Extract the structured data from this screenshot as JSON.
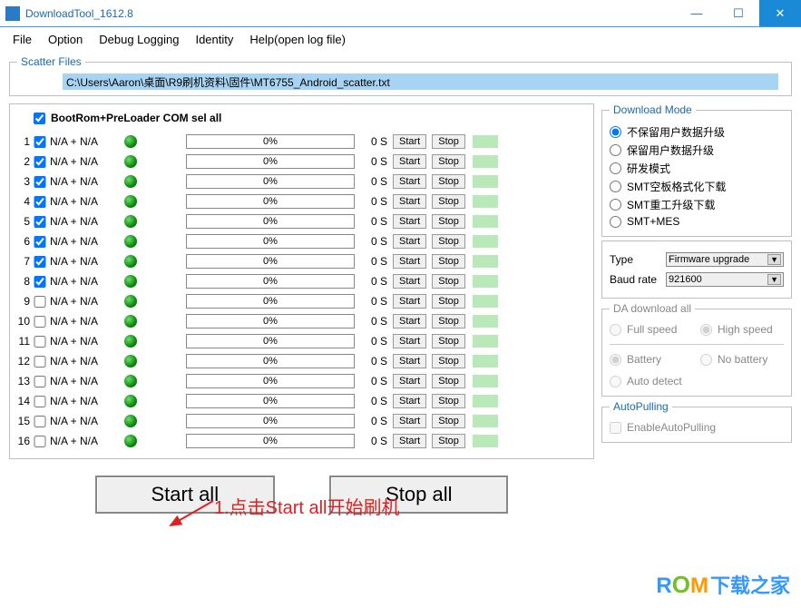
{
  "window": {
    "title": "DownloadTool_1612.8"
  },
  "menu": {
    "file": "File",
    "option": "Option",
    "debug": "Debug Logging",
    "identity": "Identity",
    "help": "Help(open log file)"
  },
  "scatter": {
    "legend": "Scatter Files",
    "path": "C:\\Users\\Aaron\\桌面\\R9刷机资料\\固件\\MT6755_Android_scatter.txt"
  },
  "selAll": {
    "label": "BootRom+PreLoader COM sel all"
  },
  "rowLabels": {
    "start": "Start",
    "stop": "Stop"
  },
  "rows": [
    {
      "n": "1",
      "chk": true,
      "name": "N/A + N/A",
      "pct": "0%",
      "t": "0 S"
    },
    {
      "n": "2",
      "chk": true,
      "name": "N/A + N/A",
      "pct": "0%",
      "t": "0 S"
    },
    {
      "n": "3",
      "chk": true,
      "name": "N/A + N/A",
      "pct": "0%",
      "t": "0 S"
    },
    {
      "n": "4",
      "chk": true,
      "name": "N/A + N/A",
      "pct": "0%",
      "t": "0 S"
    },
    {
      "n": "5",
      "chk": true,
      "name": "N/A + N/A",
      "pct": "0%",
      "t": "0 S"
    },
    {
      "n": "6",
      "chk": true,
      "name": "N/A + N/A",
      "pct": "0%",
      "t": "0 S"
    },
    {
      "n": "7",
      "chk": true,
      "name": "N/A + N/A",
      "pct": "0%",
      "t": "0 S"
    },
    {
      "n": "8",
      "chk": true,
      "name": "N/A + N/A",
      "pct": "0%",
      "t": "0 S"
    },
    {
      "n": "9",
      "chk": false,
      "name": "N/A + N/A",
      "pct": "0%",
      "t": "0 S"
    },
    {
      "n": "10",
      "chk": false,
      "name": "N/A + N/A",
      "pct": "0%",
      "t": "0 S"
    },
    {
      "n": "11",
      "chk": false,
      "name": "N/A + N/A",
      "pct": "0%",
      "t": "0 S"
    },
    {
      "n": "12",
      "chk": false,
      "name": "N/A + N/A",
      "pct": "0%",
      "t": "0 S"
    },
    {
      "n": "13",
      "chk": false,
      "name": "N/A + N/A",
      "pct": "0%",
      "t": "0 S"
    },
    {
      "n": "14",
      "chk": false,
      "name": "N/A + N/A",
      "pct": "0%",
      "t": "0 S"
    },
    {
      "n": "15",
      "chk": false,
      "name": "N/A + N/A",
      "pct": "0%",
      "t": "0 S"
    },
    {
      "n": "16",
      "chk": false,
      "name": "N/A + N/A",
      "pct": "0%",
      "t": "0 S"
    }
  ],
  "bigButtons": {
    "startAll": "Start all",
    "stopAll": "Stop all"
  },
  "downloadMode": {
    "legend": "Download Mode",
    "opts": [
      "不保留用户数据升级",
      "保留用户数据升级",
      "研发模式",
      "SMT空板格式化下载",
      "SMT重工升级下载",
      "SMT+MES"
    ]
  },
  "type": {
    "label": "Type",
    "value": "Firmware upgrade"
  },
  "baud": {
    "label": "Baud rate",
    "value": "921600"
  },
  "da": {
    "legend": "DA download all",
    "fullSpeed": "Full speed",
    "highSpeed": "High speed",
    "battery": "Battery",
    "noBattery": "No battery",
    "autoDetect": "Auto detect"
  },
  "autopull": {
    "legend": "AutoPulling",
    "enable": "EnableAutoPulling"
  },
  "annotation": "1.点击Start all开始刷机",
  "watermark": {
    "r": "R",
    "o": "O",
    "m": "M",
    "cn": "下载之家"
  }
}
